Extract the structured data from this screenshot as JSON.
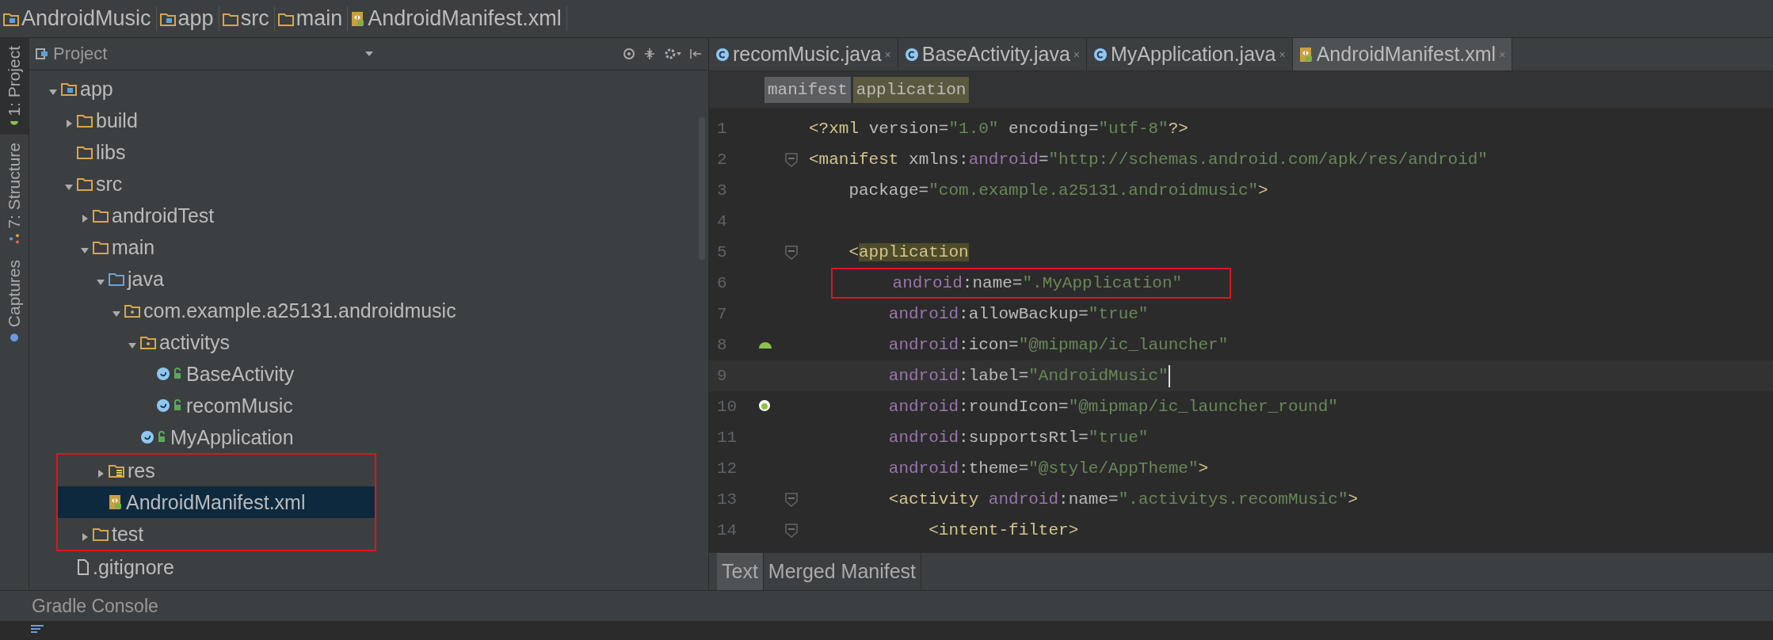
{
  "breadcrumb": [
    {
      "label": "AndroidMusic",
      "kind": "module"
    },
    {
      "label": "app",
      "kind": "module"
    },
    {
      "label": "src",
      "kind": "folder"
    },
    {
      "label": "main",
      "kind": "folder"
    },
    {
      "label": "AndroidManifest.xml",
      "kind": "manifest"
    }
  ],
  "tool_strip": [
    {
      "label": "1: Project",
      "kind": "android",
      "selected": true
    },
    {
      "label": "7: Structure",
      "kind": "structure",
      "selected": false
    },
    {
      "label": "Captures",
      "kind": "capture",
      "selected": false
    }
  ],
  "project_panel": {
    "title": "Project",
    "tree": [
      {
        "label": "app",
        "kind": "module",
        "expanded": true,
        "selected": false,
        "boxed": false,
        "children": [
          {
            "label": "build",
            "kind": "folder",
            "expanded": false,
            "selected": false,
            "boxed": false
          },
          {
            "label": "libs",
            "kind": "folder",
            "selected": false,
            "boxed": false
          },
          {
            "label": "src",
            "kind": "folder",
            "expanded": true,
            "selected": false,
            "boxed": false,
            "children": [
              {
                "label": "androidTest",
                "kind": "folder",
                "expanded": false,
                "selected": false,
                "boxed": false
              },
              {
                "label": "main",
                "kind": "folder",
                "expanded": true,
                "selected": false,
                "boxed": false,
                "children": [
                  {
                    "label": "java",
                    "kind": "source",
                    "expanded": true,
                    "selected": false,
                    "boxed": false,
                    "children": [
                      {
                        "label": "com.example.a25131.androidmusic",
                        "kind": "package",
                        "expanded": true,
                        "selected": false,
                        "boxed": false,
                        "children": [
                          {
                            "label": "activitys",
                            "kind": "package",
                            "expanded": true,
                            "selected": false,
                            "boxed": false,
                            "children": [
                              {
                                "label": "BaseActivity",
                                "kind": "class",
                                "selected": false,
                                "boxed": false
                              },
                              {
                                "label": "recomMusic",
                                "kind": "class",
                                "selected": false,
                                "boxed": false
                              }
                            ]
                          },
                          {
                            "label": "MyApplication",
                            "kind": "class",
                            "selected": false,
                            "boxed": false
                          }
                        ]
                      }
                    ]
                  },
                  {
                    "label": "res",
                    "kind": "resources",
                    "expanded": false,
                    "selected": false,
                    "boxed": true
                  },
                  {
                    "label": "AndroidManifest.xml",
                    "kind": "manifest",
                    "selected": true,
                    "boxed": true
                  }
                ]
              },
              {
                "label": "test",
                "kind": "folder",
                "expanded": false,
                "selected": false,
                "boxed": true
              }
            ]
          },
          {
            "label": ".gitignore",
            "kind": "file",
            "selected": false,
            "boxed": false
          }
        ]
      }
    ]
  },
  "editor": {
    "tabs": [
      {
        "label": "recomMusic.java",
        "kind": "class",
        "close": "×",
        "selected": false
      },
      {
        "label": "BaseActivity.java",
        "kind": "class",
        "close": "×",
        "selected": false
      },
      {
        "label": "MyApplication.java",
        "kind": "class",
        "close": "×",
        "selected": false
      },
      {
        "label": "AndroidManifest.xml",
        "kind": "manifest",
        "close": "×",
        "selected": true
      }
    ],
    "tag_path": [
      {
        "label": "manifest",
        "selected": false
      },
      {
        "label": "application",
        "selected": true
      }
    ],
    "lines": [
      {
        "number": "1",
        "fold": false,
        "kind": "plain",
        "current": false,
        "boxed": false,
        "segments": [
          {
            "text": "<?xml ",
            "kind": "tag"
          },
          {
            "text": "version=",
            "kind": "attr"
          },
          {
            "text": "\"1.0\"",
            "kind": "str"
          },
          {
            "text": " encoding=",
            "kind": "attr"
          },
          {
            "text": "\"utf-8\"",
            "kind": "str"
          },
          {
            "text": "?>",
            "kind": "tag"
          }
        ]
      },
      {
        "number": "2",
        "fold": true,
        "kind": "plain",
        "current": false,
        "boxed": false,
        "segments": [
          {
            "text": "<manifest ",
            "kind": "tag"
          },
          {
            "text": "xmlns:",
            "kind": "attr"
          },
          {
            "text": "android",
            "kind": "ns"
          },
          {
            "text": "=",
            "kind": "attr"
          },
          {
            "text": "\"http://schemas.android.com/apk/res/android\"",
            "kind": "str"
          }
        ]
      },
      {
        "number": "3",
        "fold": false,
        "kind": "plain",
        "current": false,
        "boxed": false,
        "segments": [
          {
            "text": "    package=",
            "kind": "attr"
          },
          {
            "text": "\"com.example.a25131.androidmusic\"",
            "kind": "str"
          },
          {
            "text": ">",
            "kind": "tag"
          }
        ]
      },
      {
        "number": "4",
        "fold": false,
        "kind": "plain",
        "current": false
      },
      {
        "number": "5",
        "fold": true,
        "kind": "plain",
        "current": false,
        "boxed": false,
        "segments": [
          {
            "text": "    <",
            "kind": "tag"
          },
          {
            "text": "application",
            "kind": "match"
          }
        ]
      },
      {
        "number": "6",
        "fold": false,
        "kind": "plain",
        "current": false,
        "boxed": true,
        "segments": [
          {
            "text": "        android",
            "kind": "ns"
          },
          {
            "text": ":name=",
            "kind": "attr"
          },
          {
            "text": "\".MyApplication\"",
            "kind": "str"
          }
        ]
      },
      {
        "number": "7",
        "fold": false,
        "kind": "plain",
        "current": false,
        "boxed": false,
        "segments": [
          {
            "text": "        android",
            "kind": "ns"
          },
          {
            "text": ":allowBackup=",
            "kind": "attr"
          },
          {
            "text": "\"true\"",
            "kind": "str"
          }
        ]
      },
      {
        "number": "8",
        "fold": false,
        "kind": "android",
        "current": false,
        "boxed": false,
        "segments": [
          {
            "text": "        android",
            "kind": "ns"
          },
          {
            "text": ":icon=",
            "kind": "attr"
          },
          {
            "text": "\"@mipmap/ic_launcher\"",
            "kind": "str"
          }
        ]
      },
      {
        "number": "9",
        "fold": false,
        "kind": "plain",
        "current": true,
        "boxed": false,
        "segments": [
          {
            "text": "        android",
            "kind": "ns"
          },
          {
            "text": ":label=",
            "kind": "attr"
          },
          {
            "text": "\"AndroidMusic\"",
            "kind": "str"
          }
        ]
      },
      {
        "number": "10",
        "fold": false,
        "kind": "round",
        "current": false,
        "boxed": false,
        "segments": [
          {
            "text": "        android",
            "kind": "ns"
          },
          {
            "text": ":roundIcon=",
            "kind": "attr"
          },
          {
            "text": "\"@mipmap/ic_launcher_round\"",
            "kind": "str"
          }
        ]
      },
      {
        "number": "11",
        "fold": false,
        "kind": "plain",
        "current": false,
        "boxed": false,
        "segments": [
          {
            "text": "        android",
            "kind": "ns"
          },
          {
            "text": ":supportsRtl=",
            "kind": "attr"
          },
          {
            "text": "\"true\"",
            "kind": "str"
          }
        ]
      },
      {
        "number": "12",
        "fold": false,
        "kind": "plain",
        "current": false,
        "boxed": false,
        "segments": [
          {
            "text": "        android",
            "kind": "ns"
          },
          {
            "text": ":theme=",
            "kind": "attr"
          },
          {
            "text": "\"@style/AppTheme\"",
            "kind": "str"
          },
          {
            "text": ">",
            "kind": "tag"
          }
        ]
      },
      {
        "number": "13",
        "fold": true,
        "kind": "plain",
        "current": false,
        "boxed": false,
        "segments": [
          {
            "text": "        <activity ",
            "kind": "tag"
          },
          {
            "text": "android",
            "kind": "ns"
          },
          {
            "text": ":name=",
            "kind": "attr"
          },
          {
            "text": "\".activitys.recomMusic\"",
            "kind": "str"
          },
          {
            "text": ">",
            "kind": "tag"
          }
        ]
      },
      {
        "number": "14",
        "fold": true,
        "kind": "plain",
        "current": false,
        "boxed": false,
        "segments": [
          {
            "text": "            <intent-filter>",
            "kind": "tag"
          }
        ]
      }
    ],
    "mode_tabs": [
      {
        "label": "Text",
        "selected": true
      },
      {
        "label": "Merged Manifest",
        "selected": false
      }
    ]
  },
  "bottom_panel": {
    "title": "Gradle Console"
  }
}
